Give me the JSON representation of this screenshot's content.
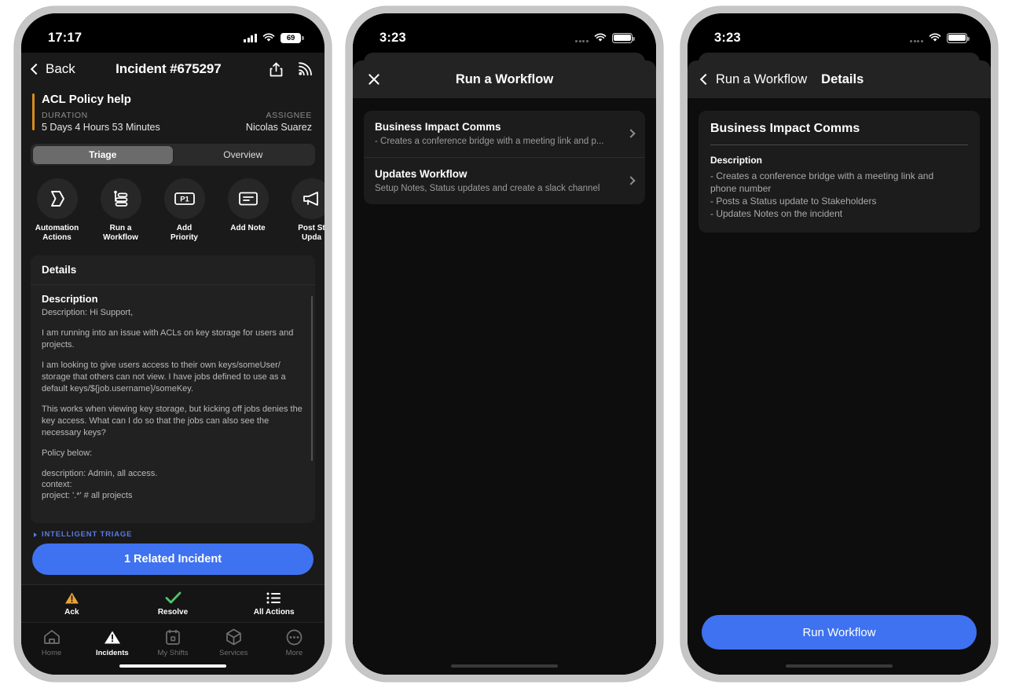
{
  "phone1": {
    "status_bar": {
      "time": "17:17",
      "battery_level": "69",
      "wifi_icon": "wifi-icon",
      "signal_icon": "cellular-signal-icon"
    },
    "navbar": {
      "back_label": "Back",
      "title": "Incident #675297",
      "share_icon": "share-icon",
      "broadcast_icon": "broadcast-icon"
    },
    "incident": {
      "title": "ACL Policy help",
      "duration_label": "DURATION",
      "duration_value": "5 Days 4 Hours 53 Minutes",
      "assignee_label": "ASSIGNEE",
      "assignee_value": "Nicolas Suarez",
      "accent_color": "#d98b1f"
    },
    "segments": [
      {
        "label": "Triage",
        "active": true
      },
      {
        "label": "Overview",
        "active": false
      }
    ],
    "actions": [
      {
        "label": "Automation\nActions",
        "line1": "Automation",
        "line2": "Actions",
        "icon": "automation-icon"
      },
      {
        "label": "Run a Workflow",
        "line1": "Run a",
        "line2": "Workflow",
        "icon": "workflow-icon"
      },
      {
        "label": "Add Priority",
        "line1": "Add",
        "line2": "Priority",
        "icon": "priority-p1-icon"
      },
      {
        "label": "Add Note",
        "line1": "Add Note",
        "line2": "",
        "icon": "note-icon"
      },
      {
        "label": "Post Status Update",
        "line1": "Post St",
        "line2": "Upda",
        "icon": "megaphone-icon"
      }
    ],
    "details": {
      "card_header": "Details",
      "section_heading": "Description",
      "paragraphs": [
        "Description: Hi Support,",
        "I am running into an issue with ACLs on key storage for users and projects.",
        "I am looking to give users access to their own keys/someUser/ storage that others can not view. I have jobs defined to use as a default keys/${job.username}/someKey.",
        "This works when viewing key storage, but kicking off jobs denies the key access. What can I do so that the jobs can also see the necessary keys?",
        "Policy below:"
      ],
      "policy_lines": [
        "description: Admin, all access.",
        "context:",
        "  project: '.*' # all projects"
      ]
    },
    "triage_link": "INTELLIGENT TRIAGE",
    "related_button": "1 Related Incident",
    "quick_actions": [
      {
        "label": "Ack",
        "icon": "warning-triangle-icon",
        "color": "#e8a33d"
      },
      {
        "label": "Resolve",
        "icon": "check-icon",
        "color": "#4cc764"
      },
      {
        "label": "All Actions",
        "icon": "list-icon",
        "color": "#ffffff"
      }
    ],
    "tabs": [
      {
        "label": "Home",
        "icon": "home-icon",
        "active": false
      },
      {
        "label": "Incidents",
        "icon": "incidents-icon",
        "active": true
      },
      {
        "label": "My Shifts",
        "icon": "calendar-icon",
        "active": false
      },
      {
        "label": "Services",
        "icon": "cube-icon",
        "active": false
      },
      {
        "label": "More",
        "icon": "more-ellipsis-icon",
        "active": false
      }
    ]
  },
  "phone2": {
    "status_bar": {
      "time": "3:23",
      "wifi_icon": "wifi-icon",
      "signal_icon": "cellular-signal-icon",
      "battery_icon": "battery-full-icon"
    },
    "sheet": {
      "close_icon": "close-x-icon",
      "title": "Run a Workflow"
    },
    "workflows": [
      {
        "name": "Business Impact Comms",
        "description": "- Creates a conference bridge with a meeting link and p...",
        "chevron_icon": "chevron-right-icon"
      },
      {
        "name": "Updates Workflow",
        "description": "Setup Notes, Status updates and create a slack channel",
        "chevron_icon": "chevron-right-icon"
      }
    ]
  },
  "phone3": {
    "status_bar": {
      "time": "3:23",
      "wifi_icon": "wifi-icon",
      "signal_icon": "cellular-signal-icon",
      "battery_icon": "battery-full-icon"
    },
    "sheet": {
      "back_icon": "chevron-left-icon",
      "back_label": "Run a Workflow",
      "title": "Details"
    },
    "detail": {
      "title": "Business Impact Comms",
      "description_heading": "Description",
      "description_lines": [
        "- Creates a conference bridge with a meeting link and",
        "phone number",
        "- Posts a Status update to Stakeholders",
        "- Updates Notes on the incident"
      ]
    },
    "run_button": "Run Workflow"
  },
  "colors": {
    "accent_blue": "#3f72f0",
    "warning_orange": "#e8a33d",
    "success_green": "#4cc764",
    "incident_bar": "#d98b1f",
    "triage_link": "#5b7be0"
  }
}
